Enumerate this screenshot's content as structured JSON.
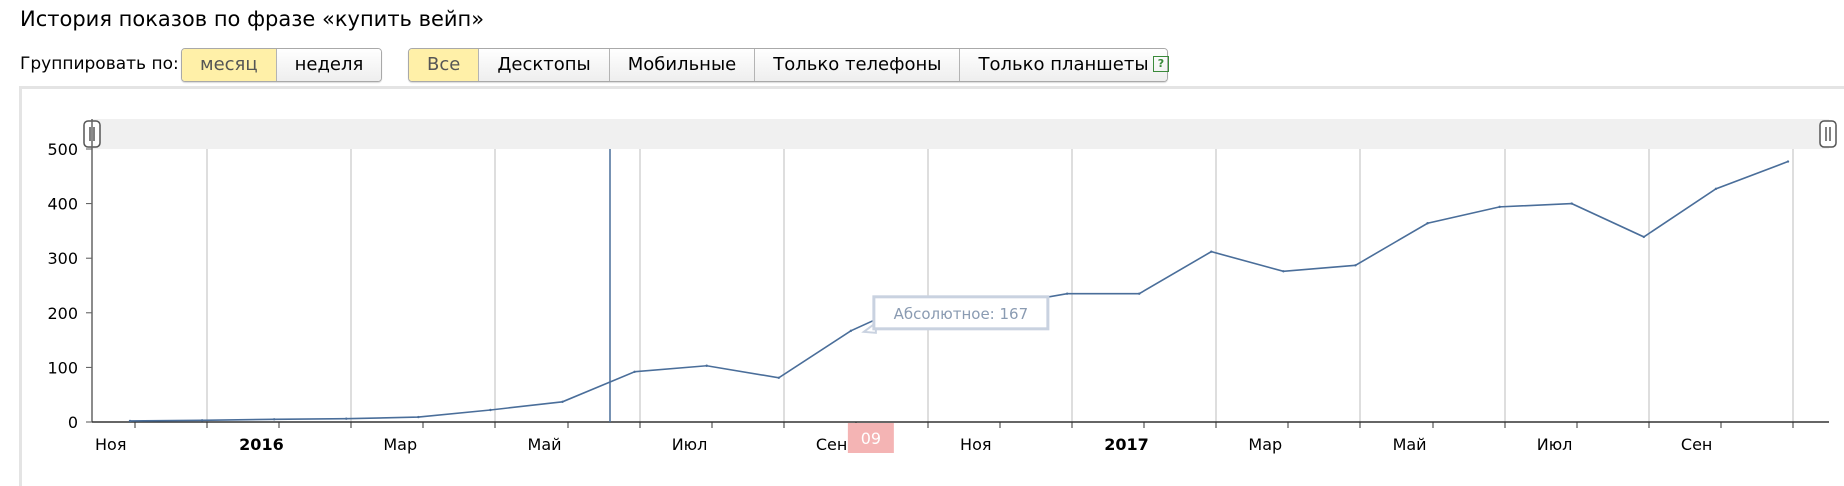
{
  "header": {
    "title": "История показов по фразе «купить вейп»"
  },
  "grouping": {
    "label": "Группировать по:",
    "options": [
      {
        "label": "месяц",
        "active": true
      },
      {
        "label": "неделя",
        "active": false
      }
    ]
  },
  "devices": {
    "options": [
      {
        "label": "Все",
        "active": true
      },
      {
        "label": "Десктопы",
        "active": false
      },
      {
        "label": "Мобильные",
        "active": false
      },
      {
        "label": "Только телефоны",
        "active": false
      },
      {
        "label": "Только планшеты",
        "active": false
      }
    ],
    "help_label": "?"
  },
  "chart_data": {
    "type": "line",
    "x_labels": [
      {
        "label": "Ноя",
        "bold": false
      },
      {
        "label": "2016",
        "bold": true
      },
      {
        "label": "Мар",
        "bold": false
      },
      {
        "label": "Май",
        "bold": false
      },
      {
        "label": "Июл",
        "bold": false
      },
      {
        "label": "Сен",
        "bold": false
      },
      {
        "label": "Ноя",
        "bold": false
      },
      {
        "label": "2017",
        "bold": true
      },
      {
        "label": "Мар",
        "bold": false
      },
      {
        "label": "Май",
        "bold": false
      },
      {
        "label": "Июл",
        "bold": false
      },
      {
        "label": "Сен",
        "bold": false
      }
    ],
    "x": [
      "2015-11",
      "2015-12",
      "2016-01",
      "2016-02",
      "2016-03",
      "2016-04",
      "2016-05",
      "2016-06",
      "2016-07",
      "2016-08",
      "2016-09",
      "2016-10",
      "2016-11",
      "2016-12",
      "2017-01",
      "2017-02",
      "2017-03",
      "2017-04",
      "2017-05",
      "2017-06",
      "2017-07",
      "2017-08",
      "2017-09",
      "2017-10"
    ],
    "series": [
      {
        "values": [
          2,
          3,
          5,
          6,
          9,
          22,
          37,
          92,
          103,
          81,
          167,
          227,
          212,
          235,
          235,
          312,
          276,
          287,
          364,
          394,
          400,
          339,
          427,
          477
        ]
      }
    ],
    "ylim": [
      0,
      500
    ],
    "y_ticks": [
      0,
      100,
      200,
      300,
      400,
      500
    ],
    "grid": true,
    "crosshair_month": "2016-06",
    "tooltip": {
      "text": "Абсолютное: 167"
    },
    "axis_marker": {
      "text": "09"
    },
    "line_color": "#4a6e9a"
  }
}
